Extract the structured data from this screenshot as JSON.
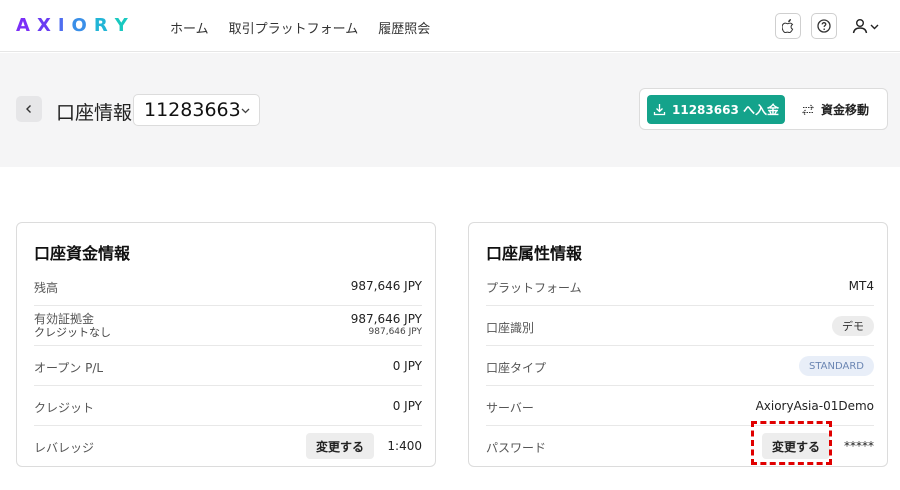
{
  "brand": {
    "logo_letters": [
      "A",
      "X",
      "I",
      "O",
      "R",
      "Y"
    ],
    "logo_colors": [
      "#7b2ff7",
      "#6a3df2",
      "#4f6ef0",
      "#3a8fe8",
      "#22b5d6",
      "#19c9c0"
    ]
  },
  "nav": {
    "items": [
      "ホーム",
      "取引プラットフォーム",
      "履歴照会"
    ]
  },
  "header": {
    "title": "口座情報",
    "account_number": "11283663",
    "deposit_label": "11283663 へ入金",
    "transfer_label": "資金移動"
  },
  "funds_card": {
    "title": "口座資金情報",
    "balance_label": "残高",
    "balance_value": "987,646 JPY",
    "margin_label": "有効証拠金",
    "margin_sub_label": "クレジットなし",
    "margin_value": "987,646 JPY",
    "margin_sub_value": "987,646 JPY",
    "open_pl_label": "オープン P/L",
    "open_pl_value": "0 JPY",
    "credit_label": "クレジット",
    "credit_value": "0 JPY",
    "leverage_label": "レバレッジ",
    "leverage_change_label": "変更する",
    "leverage_value": "1:400"
  },
  "attributes_card": {
    "title": "口座属性情報",
    "platform_label": "プラットフォーム",
    "platform_value": "MT4",
    "account_kind_label": "口座識別",
    "account_kind_value": "デモ",
    "account_type_label": "口座タイプ",
    "account_type_value": "STANDARD",
    "server_label": "サーバー",
    "server_value": "AxioryAsia-01Demo",
    "password_label": "パスワード",
    "password_change_label": "変更する",
    "password_value": "*****"
  },
  "colors": {
    "accent": "#14a38b",
    "highlight": "#e00000"
  },
  "icons": [
    "apple-icon",
    "help-icon",
    "user-icon",
    "chevron-down-icon",
    "back-arrow-icon",
    "download-icon",
    "transfer-arrows-icon"
  ]
}
